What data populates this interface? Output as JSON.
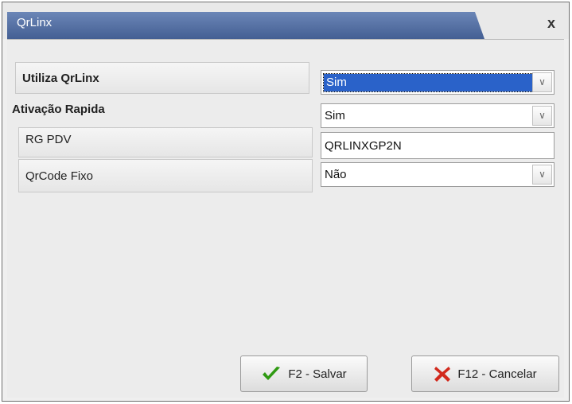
{
  "window": {
    "title": "QrLinx",
    "close_glyph": "x"
  },
  "fields": [
    {
      "label": "Utiliza QrLinx",
      "value": "Sim",
      "type": "select"
    },
    {
      "label": "Ativação Rapida",
      "value": "Sim",
      "type": "select"
    },
    {
      "label": "RG PDV",
      "value": "QRLINXGP2N",
      "type": "text"
    },
    {
      "label": "QrCode Fixo",
      "value": "Não",
      "type": "select"
    }
  ],
  "buttons": {
    "save": "F2 - Salvar",
    "cancel": "F12 - Cancelar"
  },
  "icons": {
    "dropdown": "chevron-down-icon",
    "save": "check-icon",
    "cancel": "x-icon"
  },
  "colors": {
    "title_bar": "#516ea3",
    "selection": "#2a62c9",
    "check": "#2f9a12",
    "cancel": "#d2291c"
  }
}
